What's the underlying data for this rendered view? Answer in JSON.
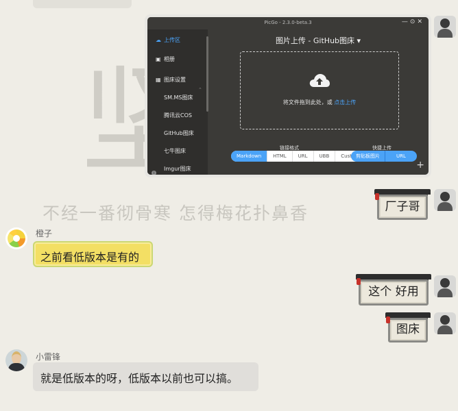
{
  "background": {
    "big_char": "坚",
    "quote": "不经一番彻骨寒 怎得梅花扑鼻香"
  },
  "picgo": {
    "window_title": "PicGo - 2.3.0-beta.3",
    "window_controls": "—⊙✕",
    "sidebar": {
      "upload": "上传区",
      "album": "相册",
      "settings": "图床设置",
      "hosts": [
        "SM.MS图床",
        "腾讯云COS",
        "GitHub图床",
        "七牛图床",
        "Imgur图床"
      ]
    },
    "heading": "图片上传 - GitHub图床 ▾",
    "drop_text": "将文件拖到此处，或 ",
    "drop_link": "点击上传",
    "link_format_label": "链接格式",
    "link_formats": [
      "Markdown",
      "HTML",
      "URL",
      "UBB",
      "Custom"
    ],
    "selected_format": "Markdown",
    "quick_upload_label": "快捷上传",
    "quick_buttons": [
      "剪贴板图片",
      "URL"
    ],
    "plus": "+",
    "info": "i"
  },
  "messages": {
    "sign1": "厂子哥",
    "sender_orange": "橙子",
    "msg_orange": "之前看低版本是有的",
    "sign2": "这个 好用",
    "sign3": "图床",
    "sender_xlf": "小雷锋",
    "msg_xlf": "就是低版本的呀，低版本以前也可以搞。"
  },
  "colors": {
    "accent": "#4ba3f7",
    "bubble_yellow": "#f3df64",
    "bubble_gray": "#e0deda",
    "sign_tag": "#c7312a"
  }
}
